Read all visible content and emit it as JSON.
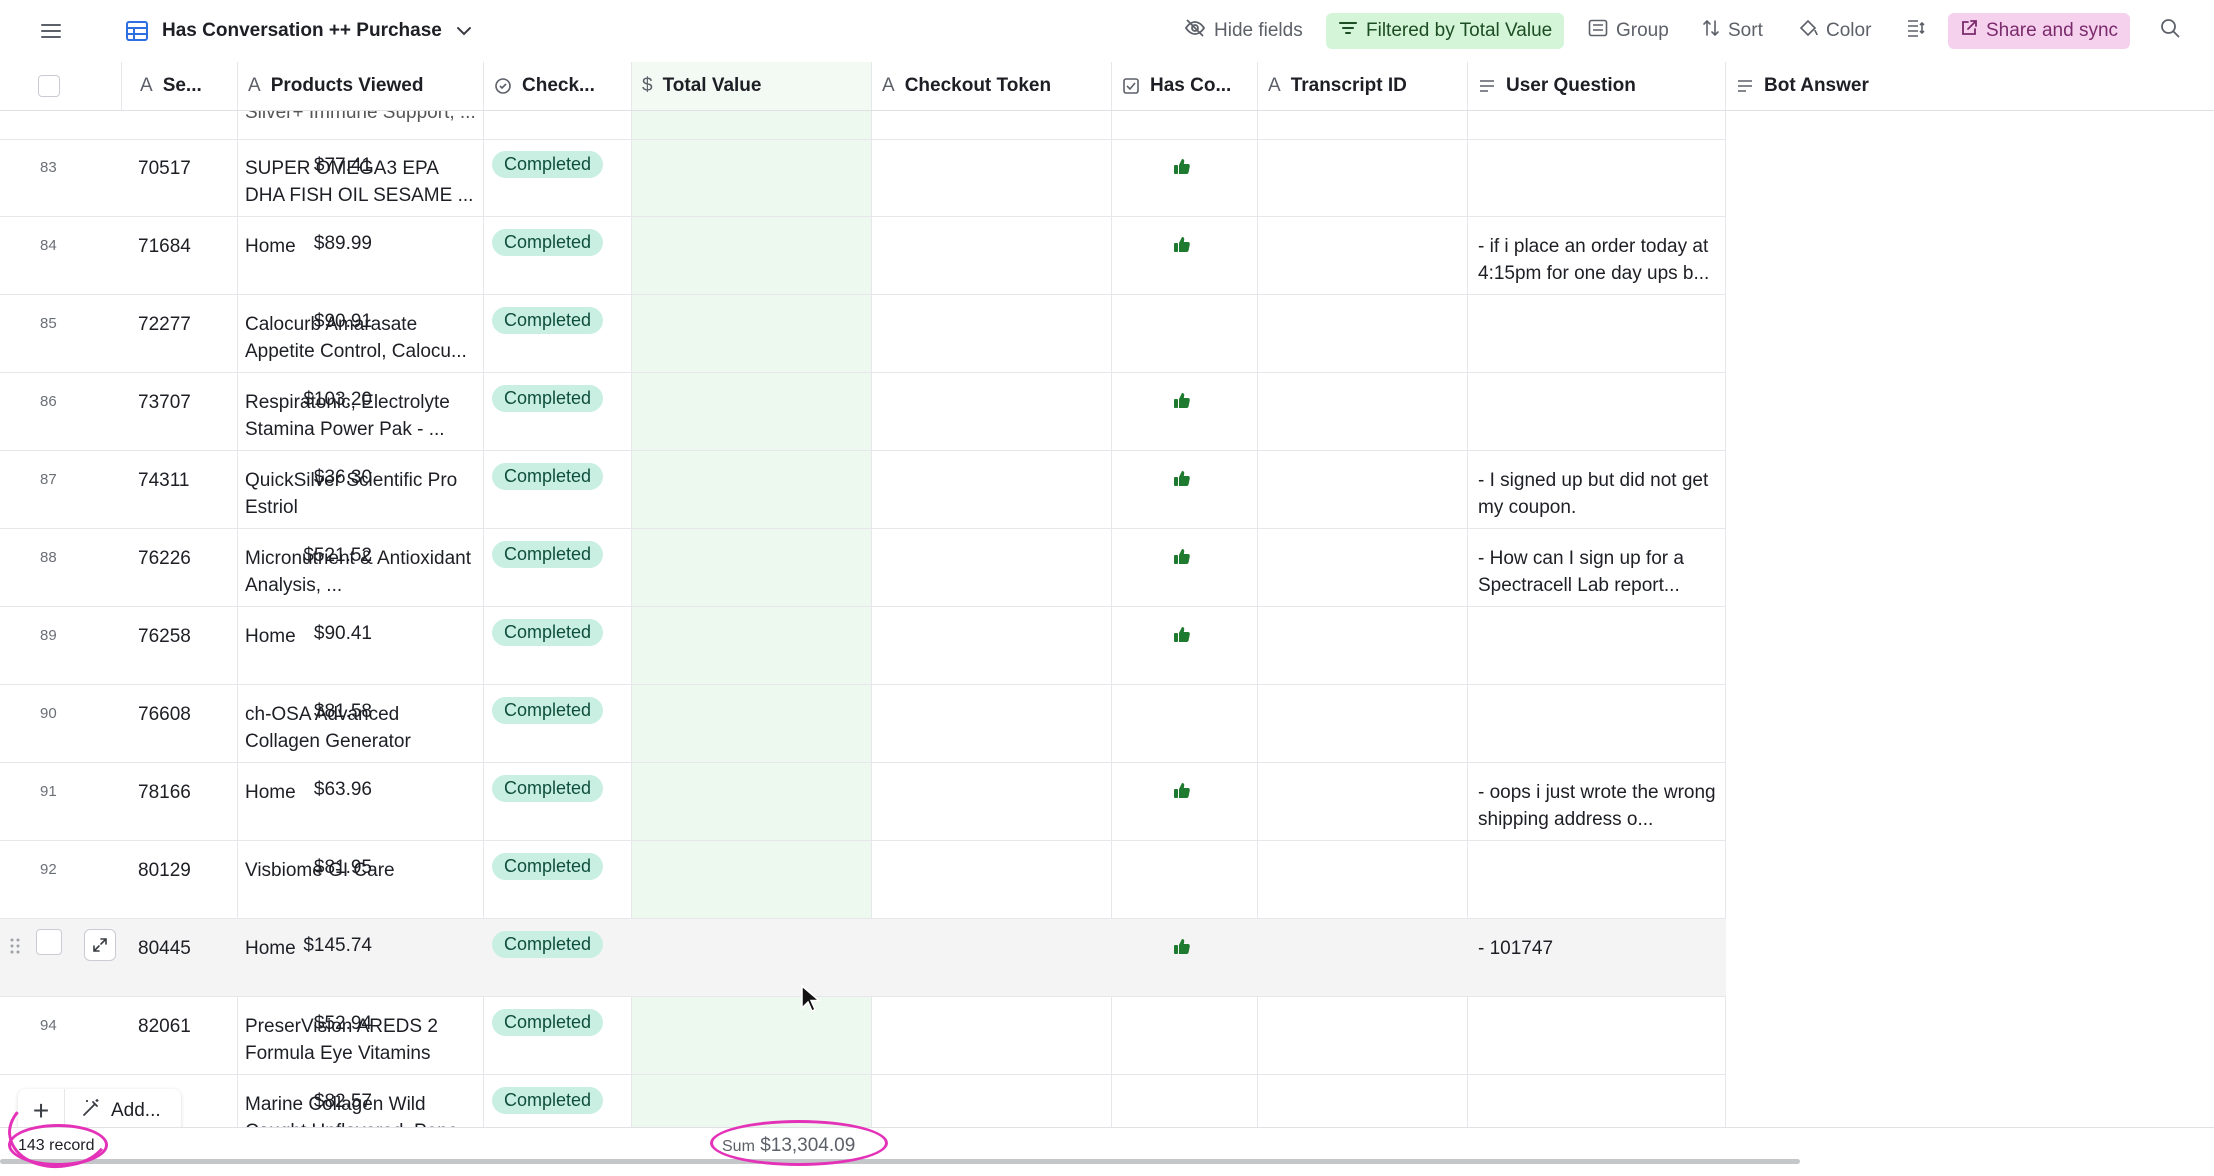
{
  "toolbar": {
    "view_name": "Has Conversation ++ Purchase",
    "hide_fields": "Hide fields",
    "filter": "Filtered by Total Value",
    "group": "Group",
    "sort": "Sort",
    "color": "Color",
    "share": "Share and sync"
  },
  "columns": {
    "seq": "Se...",
    "products": "Products Viewed",
    "checkout": "Check...",
    "total": "Total Value",
    "token": "Checkout Token",
    "hasco": "Has Co...",
    "transcript": "Transcript ID",
    "user_question": "User Question",
    "bot_answer": "Bot Answer"
  },
  "partial_top": {
    "product": "Silver+ Immune Support, ..."
  },
  "rows": [
    {
      "num": "83",
      "seq": "70517",
      "product": "SUPER OMEGA3 EPA DHA FISH OIL SESAME ...",
      "status": "Completed",
      "value": "$77.41",
      "has_conv": true,
      "question": ""
    },
    {
      "num": "84",
      "seq": "71684",
      "product": "Home",
      "status": "Completed",
      "value": "$89.99",
      "has_conv": true,
      "question": "- if i place an order today at 4:15pm for one day ups b..."
    },
    {
      "num": "85",
      "seq": "72277",
      "product": "Calocurb Amarasate Appetite Control, Calocu...",
      "status": "Completed",
      "value": "$90.91",
      "has_conv": false,
      "question": ""
    },
    {
      "num": "86",
      "seq": "73707",
      "product": "Respiratonic, Electrolyte Stamina Power Pak - ...",
      "status": "Completed",
      "value": "$103.20",
      "has_conv": true,
      "question": ""
    },
    {
      "num": "87",
      "seq": "74311",
      "product": "QuickSilver Scientific Pro Estriol",
      "status": "Completed",
      "value": "$36.30",
      "has_conv": true,
      "question": "- I signed up but did not get my coupon."
    },
    {
      "num": "88",
      "seq": "76226",
      "product": "Micronutrient & Antioxidant Analysis, ...",
      "status": "Completed",
      "value": "$521.52",
      "has_conv": true,
      "question": "- How can I sign up for a Spectracell Lab report..."
    },
    {
      "num": "89",
      "seq": "76258",
      "product": "Home",
      "status": "Completed",
      "value": "$90.41",
      "has_conv": true,
      "question": ""
    },
    {
      "num": "90",
      "seq": "76608",
      "product": "ch-OSA Advanced Collagen Generator",
      "status": "Completed",
      "value": "$81.58",
      "has_conv": false,
      "question": ""
    },
    {
      "num": "91",
      "seq": "78166",
      "product": "Home",
      "status": "Completed",
      "value": "$63.96",
      "has_conv": true,
      "question": "- oops i just wrote the wrong shipping address o..."
    },
    {
      "num": "92",
      "seq": "80129",
      "product": "Visbiome GI Care",
      "status": "Completed",
      "value": "$81.95",
      "has_conv": false,
      "question": ""
    },
    {
      "num": "",
      "seq": "80445",
      "product": "Home",
      "status": "Completed",
      "value": "$145.74",
      "has_conv": true,
      "question": "- 101747"
    },
    {
      "num": "94",
      "seq": "82061",
      "product": "PreserVision AREDS 2 Formula Eye Vitamins",
      "status": "Completed",
      "value": "$52.94",
      "has_conv": false,
      "question": ""
    },
    {
      "num": "",
      "seq": "",
      "product": "Marine Collagen Wild Caught Unflavored, Pepe...",
      "status": "Completed",
      "value": "$82.57",
      "has_conv": false,
      "question": ""
    }
  ],
  "footer": {
    "add_label": "Add...",
    "record_count": "143 record",
    "sum_label": "Sum",
    "sum_value": "$13,304.09"
  }
}
